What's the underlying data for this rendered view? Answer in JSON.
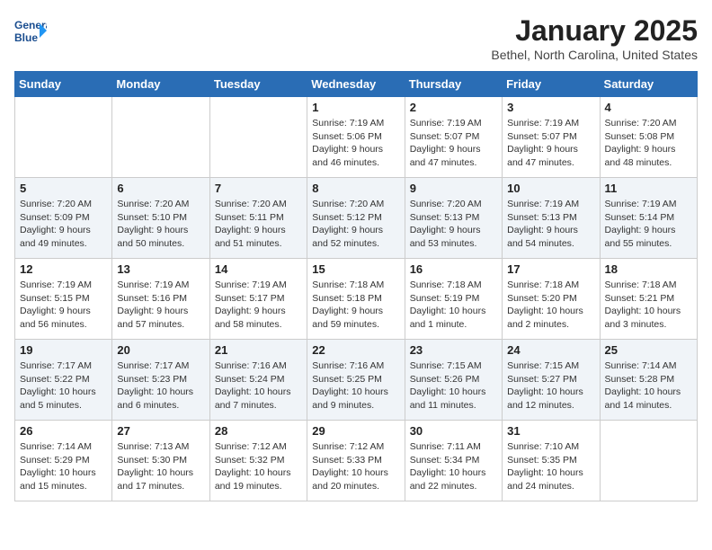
{
  "header": {
    "logo_line1": "General",
    "logo_line2": "Blue",
    "month": "January 2025",
    "location": "Bethel, North Carolina, United States"
  },
  "days_of_week": [
    "Sunday",
    "Monday",
    "Tuesday",
    "Wednesday",
    "Thursday",
    "Friday",
    "Saturday"
  ],
  "weeks": [
    [
      {
        "day": "",
        "info": ""
      },
      {
        "day": "",
        "info": ""
      },
      {
        "day": "",
        "info": ""
      },
      {
        "day": "1",
        "info": "Sunrise: 7:19 AM\nSunset: 5:06 PM\nDaylight: 9 hours\nand 46 minutes."
      },
      {
        "day": "2",
        "info": "Sunrise: 7:19 AM\nSunset: 5:07 PM\nDaylight: 9 hours\nand 47 minutes."
      },
      {
        "day": "3",
        "info": "Sunrise: 7:19 AM\nSunset: 5:07 PM\nDaylight: 9 hours\nand 47 minutes."
      },
      {
        "day": "4",
        "info": "Sunrise: 7:20 AM\nSunset: 5:08 PM\nDaylight: 9 hours\nand 48 minutes."
      }
    ],
    [
      {
        "day": "5",
        "info": "Sunrise: 7:20 AM\nSunset: 5:09 PM\nDaylight: 9 hours\nand 49 minutes."
      },
      {
        "day": "6",
        "info": "Sunrise: 7:20 AM\nSunset: 5:10 PM\nDaylight: 9 hours\nand 50 minutes."
      },
      {
        "day": "7",
        "info": "Sunrise: 7:20 AM\nSunset: 5:11 PM\nDaylight: 9 hours\nand 51 minutes."
      },
      {
        "day": "8",
        "info": "Sunrise: 7:20 AM\nSunset: 5:12 PM\nDaylight: 9 hours\nand 52 minutes."
      },
      {
        "day": "9",
        "info": "Sunrise: 7:20 AM\nSunset: 5:13 PM\nDaylight: 9 hours\nand 53 minutes."
      },
      {
        "day": "10",
        "info": "Sunrise: 7:19 AM\nSunset: 5:13 PM\nDaylight: 9 hours\nand 54 minutes."
      },
      {
        "day": "11",
        "info": "Sunrise: 7:19 AM\nSunset: 5:14 PM\nDaylight: 9 hours\nand 55 minutes."
      }
    ],
    [
      {
        "day": "12",
        "info": "Sunrise: 7:19 AM\nSunset: 5:15 PM\nDaylight: 9 hours\nand 56 minutes."
      },
      {
        "day": "13",
        "info": "Sunrise: 7:19 AM\nSunset: 5:16 PM\nDaylight: 9 hours\nand 57 minutes."
      },
      {
        "day": "14",
        "info": "Sunrise: 7:19 AM\nSunset: 5:17 PM\nDaylight: 9 hours\nand 58 minutes."
      },
      {
        "day": "15",
        "info": "Sunrise: 7:18 AM\nSunset: 5:18 PM\nDaylight: 9 hours\nand 59 minutes."
      },
      {
        "day": "16",
        "info": "Sunrise: 7:18 AM\nSunset: 5:19 PM\nDaylight: 10 hours\nand 1 minute."
      },
      {
        "day": "17",
        "info": "Sunrise: 7:18 AM\nSunset: 5:20 PM\nDaylight: 10 hours\nand 2 minutes."
      },
      {
        "day": "18",
        "info": "Sunrise: 7:18 AM\nSunset: 5:21 PM\nDaylight: 10 hours\nand 3 minutes."
      }
    ],
    [
      {
        "day": "19",
        "info": "Sunrise: 7:17 AM\nSunset: 5:22 PM\nDaylight: 10 hours\nand 5 minutes."
      },
      {
        "day": "20",
        "info": "Sunrise: 7:17 AM\nSunset: 5:23 PM\nDaylight: 10 hours\nand 6 minutes."
      },
      {
        "day": "21",
        "info": "Sunrise: 7:16 AM\nSunset: 5:24 PM\nDaylight: 10 hours\nand 7 minutes."
      },
      {
        "day": "22",
        "info": "Sunrise: 7:16 AM\nSunset: 5:25 PM\nDaylight: 10 hours\nand 9 minutes."
      },
      {
        "day": "23",
        "info": "Sunrise: 7:15 AM\nSunset: 5:26 PM\nDaylight: 10 hours\nand 11 minutes."
      },
      {
        "day": "24",
        "info": "Sunrise: 7:15 AM\nSunset: 5:27 PM\nDaylight: 10 hours\nand 12 minutes."
      },
      {
        "day": "25",
        "info": "Sunrise: 7:14 AM\nSunset: 5:28 PM\nDaylight: 10 hours\nand 14 minutes."
      }
    ],
    [
      {
        "day": "26",
        "info": "Sunrise: 7:14 AM\nSunset: 5:29 PM\nDaylight: 10 hours\nand 15 minutes."
      },
      {
        "day": "27",
        "info": "Sunrise: 7:13 AM\nSunset: 5:30 PM\nDaylight: 10 hours\nand 17 minutes."
      },
      {
        "day": "28",
        "info": "Sunrise: 7:12 AM\nSunset: 5:32 PM\nDaylight: 10 hours\nand 19 minutes."
      },
      {
        "day": "29",
        "info": "Sunrise: 7:12 AM\nSunset: 5:33 PM\nDaylight: 10 hours\nand 20 minutes."
      },
      {
        "day": "30",
        "info": "Sunrise: 7:11 AM\nSunset: 5:34 PM\nDaylight: 10 hours\nand 22 minutes."
      },
      {
        "day": "31",
        "info": "Sunrise: 7:10 AM\nSunset: 5:35 PM\nDaylight: 10 hours\nand 24 minutes."
      },
      {
        "day": "",
        "info": ""
      }
    ]
  ]
}
